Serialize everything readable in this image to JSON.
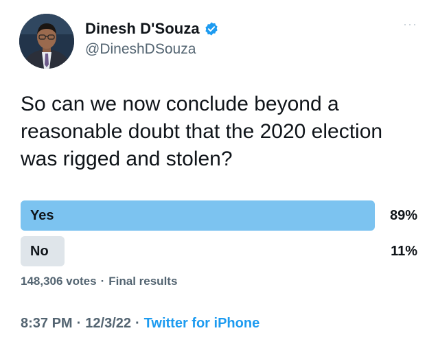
{
  "author": {
    "display_name": "Dinesh D'Souza",
    "handle": "@DineshDSouza",
    "verified": true,
    "avatar": "profile-photo"
  },
  "more_menu": "···",
  "tweet": {
    "text": "So can we now conclude beyond a reasonable doubt that the 2020 election was rigged and stolen?"
  },
  "poll": {
    "options": [
      {
        "label": "Yes",
        "percent_text": "89%",
        "percent": 89,
        "winner": true
      },
      {
        "label": "No",
        "percent_text": "11%",
        "percent": 11,
        "winner": false
      }
    ],
    "votes": "148,306 votes",
    "separator": "·",
    "status": "Final results"
  },
  "meta": {
    "time": "8:37 PM",
    "separator1": "·",
    "date": "12/3/22",
    "separator2": "·",
    "source": "Twitter for iPhone"
  },
  "colors": {
    "winner_bar": "#7cc3f0",
    "loser_bar": "#dfe5ea",
    "link": "#1d9bf0",
    "secondary_text": "#536471",
    "verified_badge": "#1d9bf0"
  }
}
